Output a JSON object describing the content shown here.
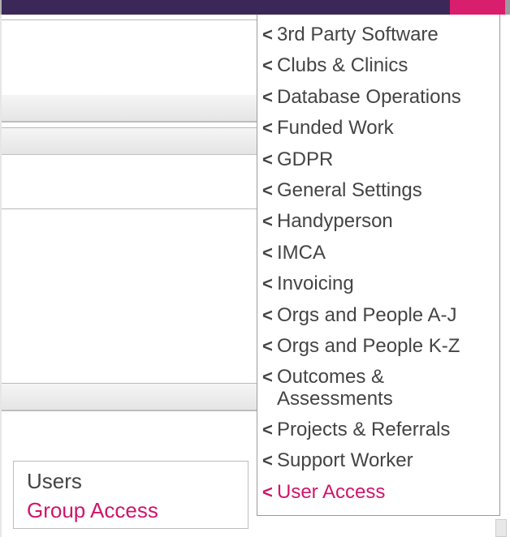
{
  "colors": {
    "accent": "#d0156b",
    "topbar": "#3b2858",
    "topbar_button": "#d81e6c"
  },
  "menu": {
    "items": [
      {
        "label": "3rd Party Software",
        "selected": false
      },
      {
        "label": "Clubs & Clinics",
        "selected": false
      },
      {
        "label": "Database Operations",
        "selected": false
      },
      {
        "label": "Funded Work",
        "selected": false
      },
      {
        "label": "GDPR",
        "selected": false
      },
      {
        "label": "General Settings",
        "selected": false
      },
      {
        "label": "Handyperson",
        "selected": false
      },
      {
        "label": "IMCA",
        "selected": false
      },
      {
        "label": "Invoicing",
        "selected": false
      },
      {
        "label": "Orgs and People A-J",
        "selected": false
      },
      {
        "label": "Orgs and People K-Z",
        "selected": false
      },
      {
        "label": "Outcomes & Assessments",
        "selected": false
      },
      {
        "label": "Projects & Referrals",
        "selected": false
      },
      {
        "label": "Support Worker",
        "selected": false
      },
      {
        "label": "User Access",
        "selected": true
      }
    ]
  },
  "mini_panel": {
    "items": [
      {
        "label": "Users",
        "active": false
      },
      {
        "label": "Group Access",
        "active": true
      }
    ]
  }
}
